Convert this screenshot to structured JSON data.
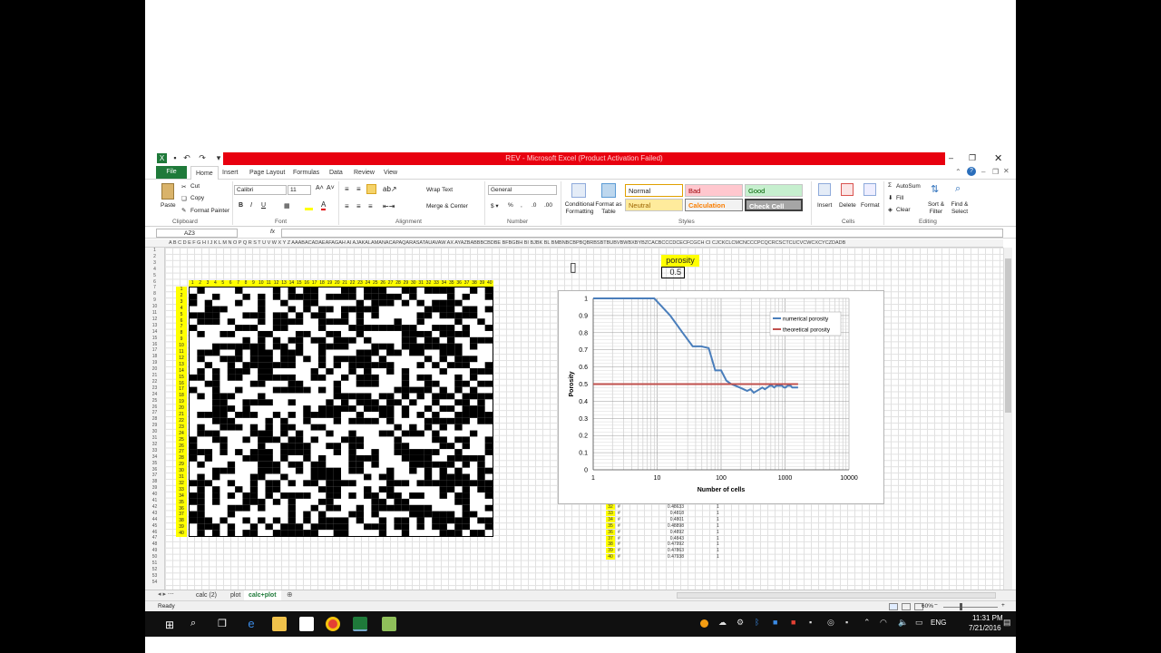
{
  "window": {
    "title": "REV - Microsoft Excel (Product Activation Failed)"
  },
  "ribbon_tabs": [
    "File",
    "Home",
    "Insert",
    "Page Layout",
    "Formulas",
    "Data",
    "Review",
    "View"
  ],
  "clipboard": {
    "paste": "Paste",
    "cut": "Cut",
    "copy": "Copy",
    "format_painter": "Format Painter",
    "group": "Clipboard"
  },
  "font": {
    "name": "Calibri",
    "size": "11",
    "group": "Font"
  },
  "alignment": {
    "wrap_text": "Wrap Text",
    "merge_center": "Merge & Center",
    "group": "Alignment"
  },
  "number": {
    "format": "General",
    "group": "Number"
  },
  "styles": {
    "conditional": "Conditional Formatting",
    "format_table": "Format as Table",
    "items": [
      {
        "label": "Normal",
        "bg": "#ffffff",
        "fg": "#000000"
      },
      {
        "label": "Bad",
        "bg": "#ffc7ce",
        "fg": "#9c0006"
      },
      {
        "label": "Good",
        "bg": "#c6efce",
        "fg": "#006100"
      },
      {
        "label": "Neutral",
        "bg": "#ffeb9c",
        "fg": "#9c6500"
      },
      {
        "label": "Calculation",
        "bg": "#f2f2f2",
        "fg": "#fa7d00"
      },
      {
        "label": "Check Cell",
        "bg": "#a5a5a5",
        "fg": "#ffffff"
      }
    ],
    "group": "Styles"
  },
  "cells": {
    "insert": "Insert",
    "delete": "Delete",
    "format": "Format",
    "group": "Cells"
  },
  "editing": {
    "autosum": "AutoSum",
    "fill": "Fill",
    "clear": "Clear",
    "sort_filter": "Sort & Filter",
    "find_select": "Find & Select",
    "group": "Editing"
  },
  "formula_bar": {
    "name_box": "AZ3",
    "fx": "fx",
    "value": ""
  },
  "column_headers_left": "A B C D E F G H I J K L M N O P Q R S T U V W X Y Z AAABACADAEAFAGAH AI AJAKALAMANACAPAQARASATAUAVAW AX AYAZBABBBCBDBE BFBGBH BI BJBK BL BMBNBCBPBQBRBSBTBUBVBWBXBYBZCACBCCCDCECFCGCH CI CJCKCLCMCNCCCPCQCRCSCTCUCVCWCXCYCZDADB",
  "porosity": {
    "label": "porosity",
    "value": "0.5"
  },
  "matrix_header": [
    "1",
    "2",
    "3",
    "4",
    "5",
    "6",
    "7",
    "8",
    "9",
    "10",
    "11",
    "12",
    "13",
    "14",
    "15",
    "16",
    "17",
    "18",
    "19",
    "20",
    "21",
    "22",
    "23",
    "24",
    "25",
    "26",
    "27",
    "28",
    "29",
    "30",
    "31",
    "32",
    "33",
    "34",
    "35",
    "36",
    "37",
    "38",
    "39",
    "40"
  ],
  "chart_data": {
    "type": "line",
    "xlabel": "Number of cells",
    "ylabel": "Porosity",
    "xscale": "log",
    "xlim": [
      1,
      10000
    ],
    "ylim": [
      0,
      1
    ],
    "xticks": [
      "1",
      "10",
      "100",
      "1000",
      "10000"
    ],
    "yticks": [
      "0",
      "0.1",
      "0.2",
      "0.3",
      "0.4",
      "0.5",
      "0.6",
      "0.7",
      "0.8",
      "0.9",
      "1"
    ],
    "legend_position": "top-right",
    "series": [
      {
        "name": "numerical porosity",
        "color": "#4a7ebb",
        "x": [
          1,
          4,
          9,
          16,
          25,
          36,
          49,
          64,
          81,
          100,
          121,
          144,
          169,
          196,
          225,
          256,
          289,
          324,
          361,
          400,
          441,
          484,
          529,
          576,
          625,
          676,
          729,
          784,
          841,
          900,
          961,
          1024,
          1089,
          1156,
          1225,
          1296,
          1369,
          1444,
          1521,
          1600
        ],
        "y": [
          1,
          1,
          1,
          0.9,
          0.8,
          0.72,
          0.72,
          0.71,
          0.58,
          0.58,
          0.52,
          0.5,
          0.49,
          0.48,
          0.47,
          0.46,
          0.47,
          0.45,
          0.46,
          0.47,
          0.48,
          0.47,
          0.48,
          0.49,
          0.49,
          0.48,
          0.49,
          0.49,
          0.49,
          0.49,
          0.48,
          0.48,
          0.49,
          0.49,
          0.49,
          0.48,
          0.48,
          0.48,
          0.48,
          0.48
        ]
      },
      {
        "name": "theoretical porosity",
        "color": "#c0504d",
        "x": [
          1,
          1600
        ],
        "y": [
          0.5,
          0.5
        ]
      }
    ]
  },
  "data_rows": [
    {
      "n": "32",
      "v": "0.48633",
      "c": "1"
    },
    {
      "n": "33",
      "v": "0.4818",
      "c": "1"
    },
    {
      "n": "34",
      "v": "0.4801",
      "c": "1"
    },
    {
      "n": "35",
      "v": "0.48898",
      "c": "1"
    },
    {
      "n": "36",
      "v": "0.4892",
      "c": "1"
    },
    {
      "n": "37",
      "v": "0.4843",
      "c": "1"
    },
    {
      "n": "38",
      "v": "0.47992",
      "c": "1"
    },
    {
      "n": "39",
      "v": "0.47863",
      "c": "1"
    },
    {
      "n": "40",
      "v": "0.47938",
      "c": "1"
    }
  ],
  "sheets": [
    "calc (2)",
    "plot",
    "calc+plot"
  ],
  "status": {
    "ready": "Ready",
    "zoom": "60%"
  },
  "taskbar": {
    "lang": "ENG",
    "time": "11:31 PM",
    "date": "7/21/2016"
  }
}
